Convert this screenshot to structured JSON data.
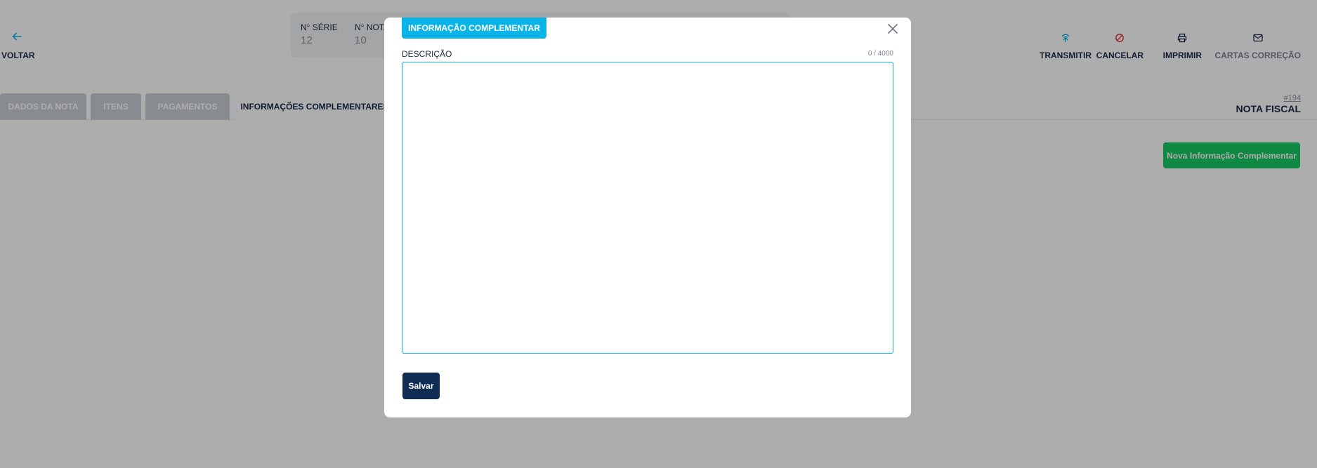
{
  "header": {
    "back_label": "VOLTAR",
    "fields": [
      {
        "label": "N° SÉRIE",
        "value": "12"
      },
      {
        "label": "N° NOTA",
        "value": "10"
      }
    ]
  },
  "toolbar": {
    "items": [
      {
        "label": "TRANSMITIR",
        "icon": "transmit-icon",
        "color": "#0ab3e8"
      },
      {
        "label": "CANCELAR",
        "icon": "cancel-icon",
        "color": "#e53935"
      },
      {
        "label": "IMPRIMIR",
        "icon": "printer-icon",
        "color": "#1b2a47"
      },
      {
        "label": "CARTAS CORREÇÃO",
        "icon": "envelope-icon",
        "color": "#1b2a47"
      }
    ]
  },
  "tabs": [
    {
      "label": "DADOS DA NOTA",
      "active": false
    },
    {
      "label": "ITENS",
      "active": false
    },
    {
      "label": "PAGAMENTOS",
      "active": false
    },
    {
      "label": "INFORMAÇÕES COMPLEMENTARES",
      "active": true
    }
  ],
  "note": {
    "number": "#194",
    "title": "NOTA FISCAL"
  },
  "actions": {
    "new_info_label": "Nova Informação Complementar"
  },
  "modal": {
    "title": "INFORMAÇÃO COMPLEMENTAR",
    "field_label": "DESCRIÇÃO",
    "char_count": "0 / 4000",
    "description_value": "",
    "save_label": "Salvar"
  },
  "colors": {
    "accent": "#0ab3e8",
    "primary_dark": "#0f2c54",
    "success": "#17c964",
    "danger": "#e53935"
  }
}
